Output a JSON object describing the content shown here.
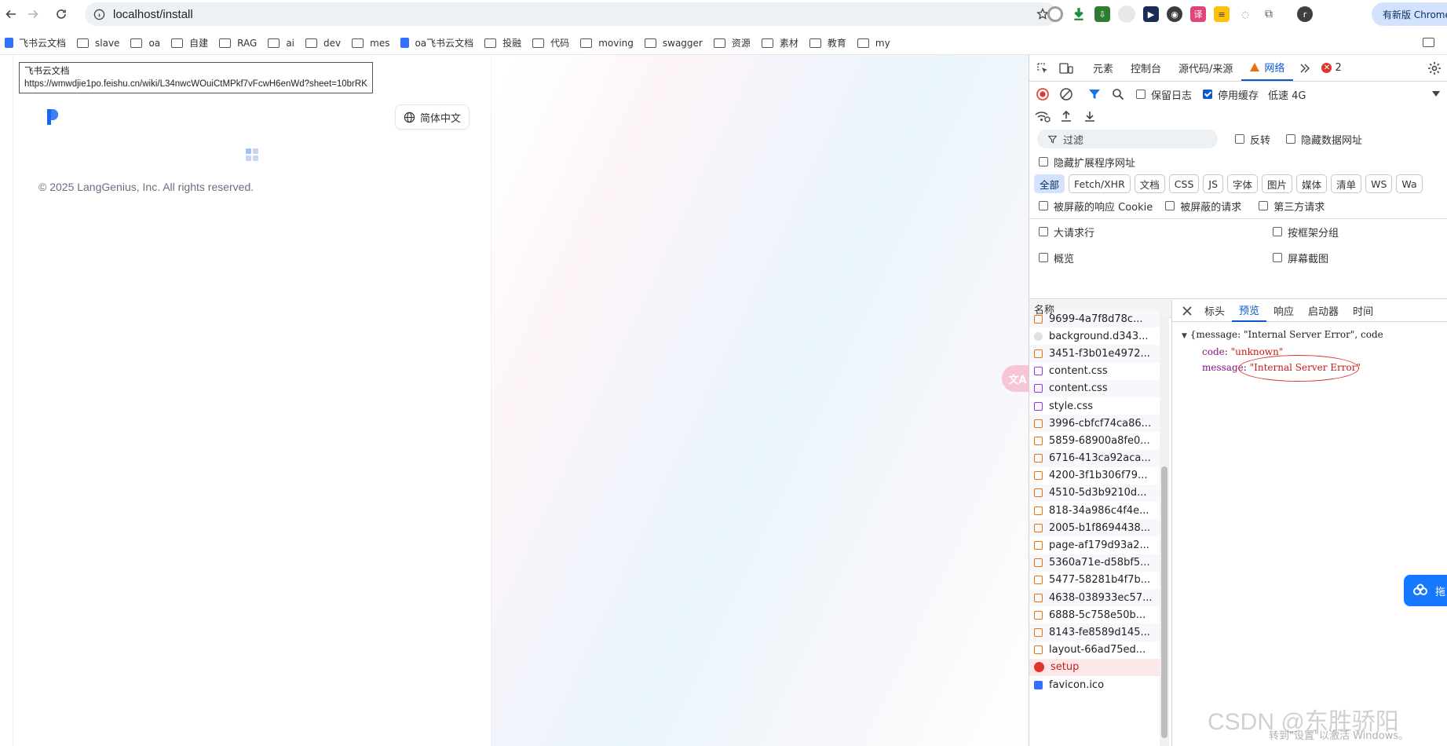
{
  "browser": {
    "url": "localhost/install",
    "update_button": "有新版 Chrome"
  },
  "bookmarks": [
    {
      "label": "飞书云文档",
      "kind": "doc"
    },
    {
      "label": "slave",
      "kind": "folder"
    },
    {
      "label": "oa",
      "kind": "folder"
    },
    {
      "label": "自建",
      "kind": "folder"
    },
    {
      "label": "RAG",
      "kind": "folder"
    },
    {
      "label": "ai",
      "kind": "folder"
    },
    {
      "label": "dev",
      "kind": "folder"
    },
    {
      "label": "mes",
      "kind": "folder"
    },
    {
      "label": "oa飞书云文档",
      "kind": "doc"
    },
    {
      "label": "投融",
      "kind": "folder"
    },
    {
      "label": "代码",
      "kind": "folder"
    },
    {
      "label": "moving",
      "kind": "folder"
    },
    {
      "label": "swagger",
      "kind": "folder"
    },
    {
      "label": "资源",
      "kind": "folder"
    },
    {
      "label": "素材",
      "kind": "folder"
    },
    {
      "label": "教育",
      "kind": "folder"
    },
    {
      "label": "my",
      "kind": "folder"
    }
  ],
  "tooltip": {
    "title": "飞书云文档",
    "url": "https://wmwdjie1po.feishu.cn/wiki/L34nwcWOuiCtMPkf7vFcwH6enWd?sheet=10brRK"
  },
  "page": {
    "language_button": "简体中文",
    "copyright": "© 2025 LangGenius, Inc. All rights reserved."
  },
  "devtools": {
    "tabs": [
      "元素",
      "控制台",
      "源代码/来源",
      "网络"
    ],
    "active_tab": "网络",
    "error_count": "2",
    "toolbar": {
      "preserve_log": "保留日志",
      "disable_cache": "停用缓存",
      "throttle": "低速 4G"
    },
    "filter": {
      "placeholder": "过滤",
      "invert": "反转",
      "hide_data_urls": "隐藏数据网址",
      "hide_extension_urls": "隐藏扩展程序网址"
    },
    "type_filters": [
      "全部",
      "Fetch/XHR",
      "文档",
      "CSS",
      "JS",
      "字体",
      "图片",
      "媒体",
      "清单",
      "WS",
      "Wa"
    ],
    "blocked": {
      "cookies": "被屏蔽的响应 Cookie",
      "requests": "被屏蔽的请求",
      "third_party": "第三方请求"
    },
    "options": {
      "big_rows": "大请求行",
      "group_by_frame": "按框架分组",
      "overview": "概览",
      "screenshots": "屏幕截图"
    },
    "requests_header": "名称",
    "requests": [
      {
        "name": "9699-4a7f8d78c...",
        "type": "js"
      },
      {
        "name": "background.d343...",
        "type": "img"
      },
      {
        "name": "3451-f3b01e4972...",
        "type": "js"
      },
      {
        "name": "content.css",
        "type": "css"
      },
      {
        "name": "content.css",
        "type": "css"
      },
      {
        "name": "style.css",
        "type": "css"
      },
      {
        "name": "3996-cbfcf74ca86...",
        "type": "js"
      },
      {
        "name": "5859-68900a8fe0...",
        "type": "js"
      },
      {
        "name": "6716-413ca92aca...",
        "type": "js"
      },
      {
        "name": "4200-3f1b306f79...",
        "type": "js"
      },
      {
        "name": "4510-5d3b9210d...",
        "type": "js"
      },
      {
        "name": "818-34a986c4f4e...",
        "type": "js"
      },
      {
        "name": "2005-b1f8694438...",
        "type": "js"
      },
      {
        "name": "page-af179d93a2...",
        "type": "js"
      },
      {
        "name": "5360a71e-d58bf5...",
        "type": "js"
      },
      {
        "name": "5477-58281b4f7b...",
        "type": "js"
      },
      {
        "name": "4638-038933ec57...",
        "type": "js"
      },
      {
        "name": "6888-5c758e50b...",
        "type": "js"
      },
      {
        "name": "8143-fe8589d145...",
        "type": "js"
      },
      {
        "name": "layout-66ad75ed...",
        "type": "js"
      },
      {
        "name": "setup",
        "type": "err"
      },
      {
        "name": "favicon.ico",
        "type": "fav"
      }
    ],
    "detail_tabs": [
      "标头",
      "预览",
      "响应",
      "启动器",
      "时间"
    ],
    "active_detail_tab": "预览",
    "preview": {
      "summary": "{message: \"Internal Server Error\", code",
      "code_key": "code",
      "code_val": "\"unknown\"",
      "message_key": "message",
      "message_val": "\"Internal Server Error\""
    },
    "side_fab": "拖"
  },
  "watermark": "CSDN @东胜骄阳",
  "windows_notice": "转到\"设置\"以激活 Windows。"
}
